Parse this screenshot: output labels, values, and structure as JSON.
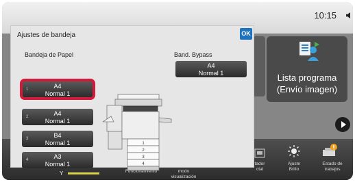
{
  "status": {
    "time": "10:15"
  },
  "dialog": {
    "title": "Ajustes de bandeja",
    "ok_label": "OK",
    "paper_trays_label": "Bandeja de Papel",
    "bypass_label": "Band. Bypass",
    "trays": [
      {
        "num": "1",
        "size": "A4",
        "type": "Normal 1"
      },
      {
        "num": "2",
        "size": "A4",
        "type": "Normal 1"
      },
      {
        "num": "3",
        "size": "B4",
        "type": "Normal 1"
      },
      {
        "num": "4",
        "size": "A3",
        "type": "Normal 1"
      }
    ],
    "bypass": {
      "size": "A4",
      "type": "Normal 1"
    },
    "printer_drawers": [
      "1",
      "2",
      "3",
      "4"
    ]
  },
  "background": {
    "tile_label_line1": "Lista programa",
    "tile_label_line2": "(Envío imagen)"
  },
  "bottom_bar": {
    "toner_label": "Y",
    "items": [
      {
        "line1": "Funcionamiento",
        "line2": ""
      },
      {
        "line1": "modo",
        "line2": "visualización"
      },
      {
        "line1": "tador",
        "line2": "ctal"
      },
      {
        "line1": "Ajuste",
        "line2": "Brillo"
      },
      {
        "line1": "Estado de",
        "line2": "trabajos"
      }
    ]
  },
  "colors": {
    "highlight": "#d21a3a",
    "ok_button": "#1e73be",
    "toner_bar": "#d8d14a"
  }
}
